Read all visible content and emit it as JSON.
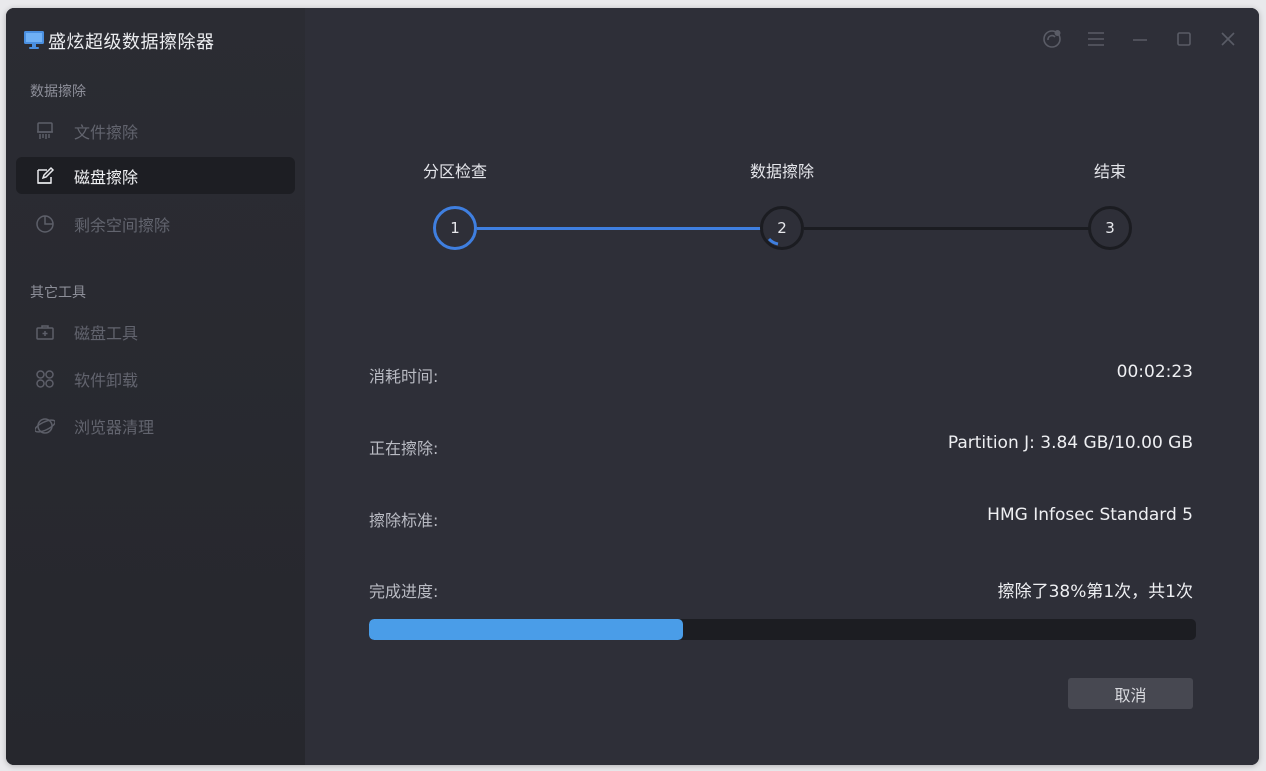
{
  "app": {
    "title": "盛炫超级数据擦除器",
    "accent": "#4a9de8"
  },
  "sidebar": {
    "sections": [
      {
        "label": "数据擦除",
        "items": [
          {
            "label": "文件擦除",
            "icon": "shredder-icon",
            "active": false
          },
          {
            "label": "磁盘擦除",
            "icon": "edit-icon",
            "active": true
          },
          {
            "label": "剩余空间擦除",
            "icon": "pie-chart-icon",
            "active": false
          }
        ]
      },
      {
        "label": "其它工具",
        "items": [
          {
            "label": "磁盘工具",
            "icon": "toolbox-icon",
            "active": false
          },
          {
            "label": "软件卸载",
            "icon": "apps-grid-icon",
            "active": false
          },
          {
            "label": "浏览器清理",
            "icon": "browser-icon",
            "active": false
          }
        ]
      }
    ]
  },
  "steps": [
    {
      "label": "分区检查",
      "number": "1",
      "state": "done"
    },
    {
      "label": "数据擦除",
      "number": "2",
      "state": "current"
    },
    {
      "label": "结束",
      "number": "3",
      "state": "pending"
    }
  ],
  "info": {
    "elapsed_label": "消耗时间:",
    "elapsed_value": "00:02:23",
    "erasing_label": "正在擦除:",
    "erasing_value": "Partition J: 3.84 GB/10.00 GB",
    "standard_label": "擦除标准:",
    "standard_value": "HMG Infosec Standard 5",
    "progress_label": "完成进度:",
    "progress_value": "擦除了38%第1次，共1次",
    "progress_percent": 38
  },
  "actions": {
    "cancel_label": "取消"
  }
}
